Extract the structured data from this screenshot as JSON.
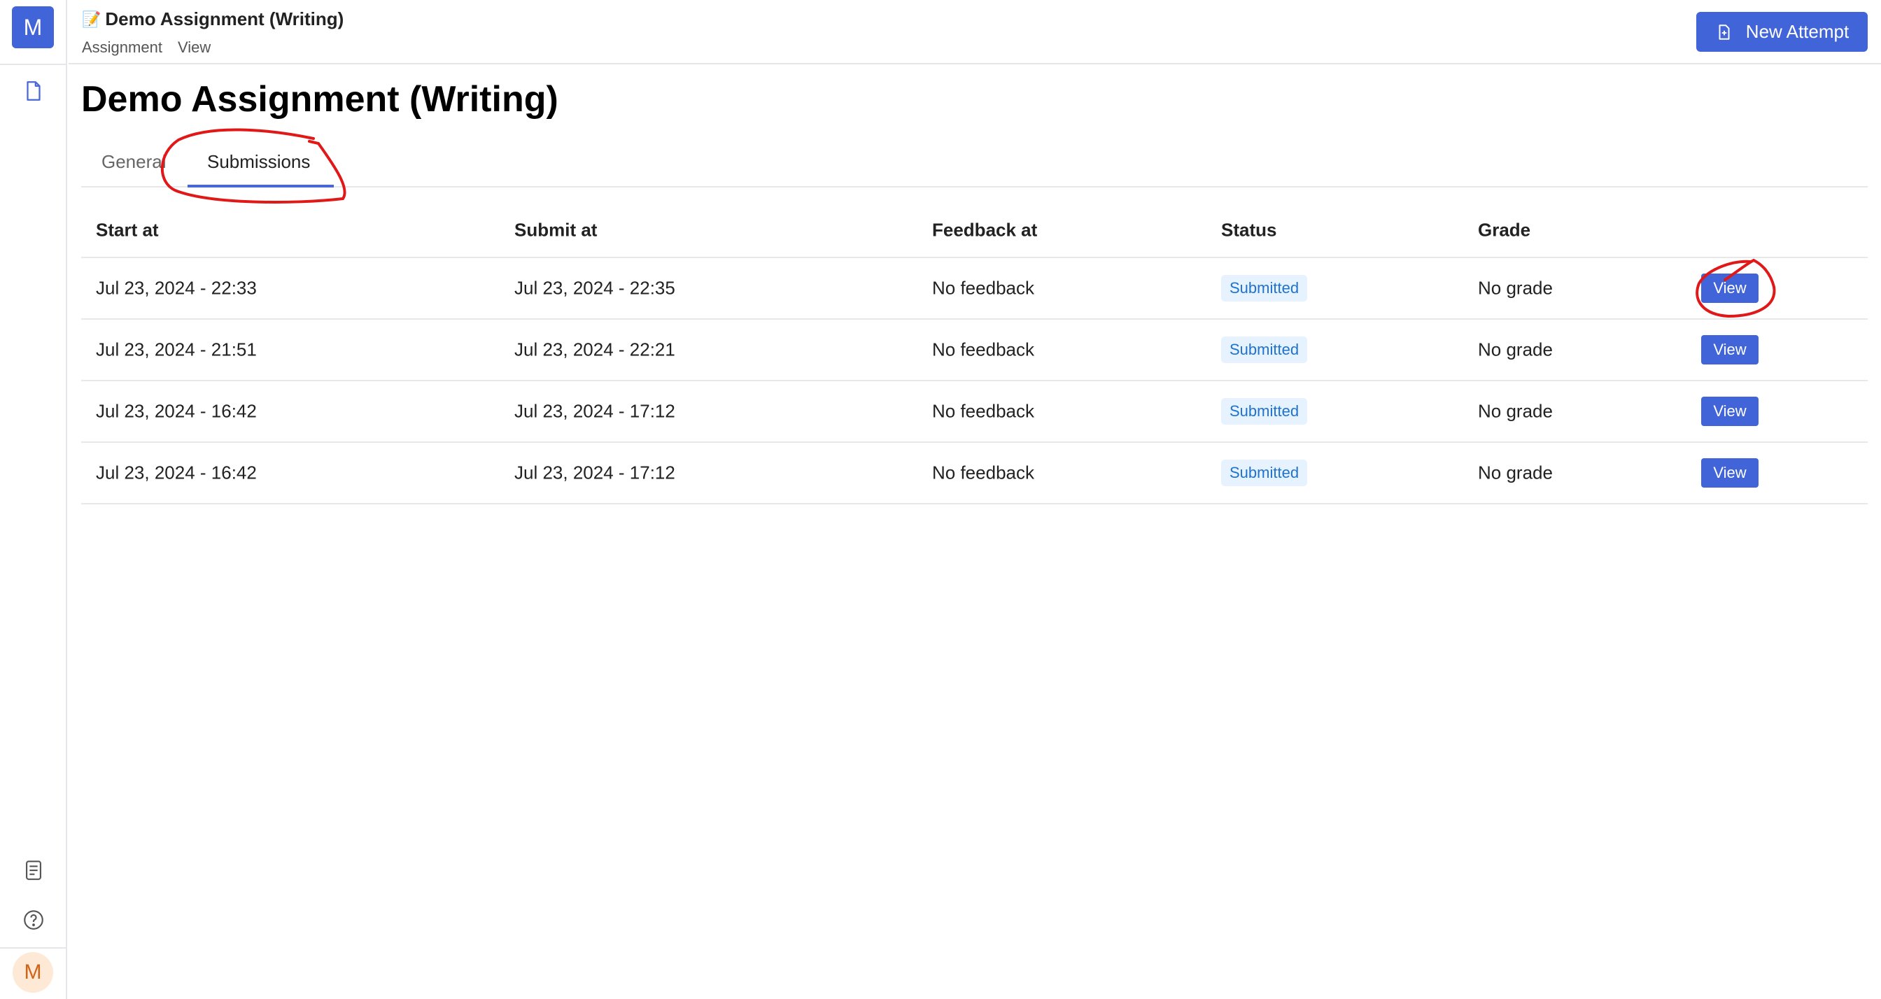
{
  "sidebar": {
    "logo_letter": "M",
    "nav_icons": [
      "document-icon"
    ],
    "bottom_icons": [
      "notes-icon",
      "help-icon"
    ],
    "avatar_letter": "M"
  },
  "header": {
    "title_icon": "memo-icon",
    "title_icon_glyph": "📝",
    "title": "Demo Assignment (Writing)",
    "breadcrumb": [
      "Assignment",
      "View"
    ],
    "new_attempt_label": "New Attempt"
  },
  "page": {
    "title": "Demo Assignment (Writing)",
    "tabs": [
      {
        "label": "General",
        "active": false
      },
      {
        "label": "Submissions",
        "active": true
      }
    ]
  },
  "table": {
    "columns": [
      "Start at",
      "Submit at",
      "Feedback at",
      "Status",
      "Grade",
      ""
    ],
    "rows": [
      {
        "start": "Jul 23, 2024 - 22:33",
        "submit": "Jul 23, 2024 - 22:35",
        "feedback": "No feedback",
        "status": "Submitted",
        "grade": "No grade",
        "action": "View"
      },
      {
        "start": "Jul 23, 2024 - 21:51",
        "submit": "Jul 23, 2024 - 22:21",
        "feedback": "No feedback",
        "status": "Submitted",
        "grade": "No grade",
        "action": "View"
      },
      {
        "start": "Jul 23, 2024 - 16:42",
        "submit": "Jul 23, 2024 - 17:12",
        "feedback": "No feedback",
        "status": "Submitted",
        "grade": "No grade",
        "action": "View"
      },
      {
        "start": "Jul 23, 2024 - 16:42",
        "submit": "Jul 23, 2024 - 17:12",
        "feedback": "No feedback",
        "status": "Submitted",
        "grade": "No grade",
        "action": "View"
      }
    ]
  },
  "colors": {
    "primary": "#4264d9",
    "badge_bg": "#e6f2fd",
    "badge_text": "#1f72cf",
    "avatar_bg": "#fde9d6",
    "avatar_text": "#d0651a",
    "annotation": "#e01818"
  }
}
